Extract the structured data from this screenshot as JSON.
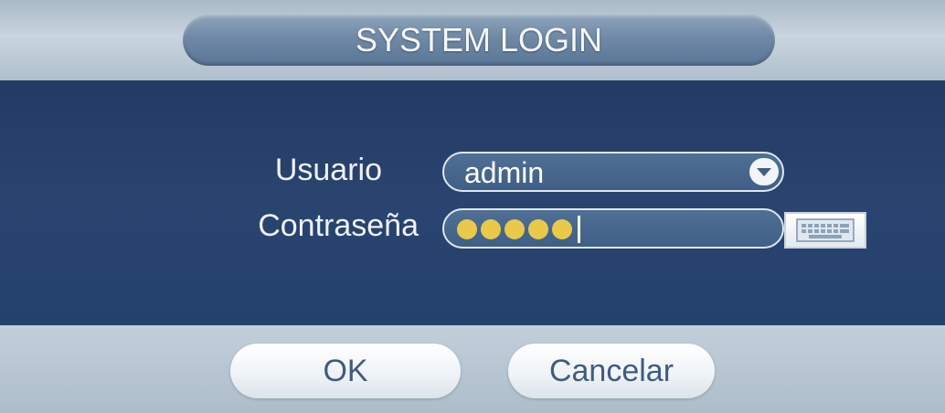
{
  "dialog": {
    "title": "SYSTEM LOGIN"
  },
  "form": {
    "user_label": "Usuario",
    "user_value": "admin",
    "password_label": "Contraseña",
    "password_masked_length": 5
  },
  "buttons": {
    "ok_label": "OK",
    "cancel_label": "Cancelar"
  },
  "icons": {
    "dropdown": "chevron-down-icon",
    "keyboard": "keyboard-icon"
  },
  "colors": {
    "panel": "#2a4470",
    "mask_dot": "#e8c94a",
    "button_text": "#3f5c80"
  }
}
